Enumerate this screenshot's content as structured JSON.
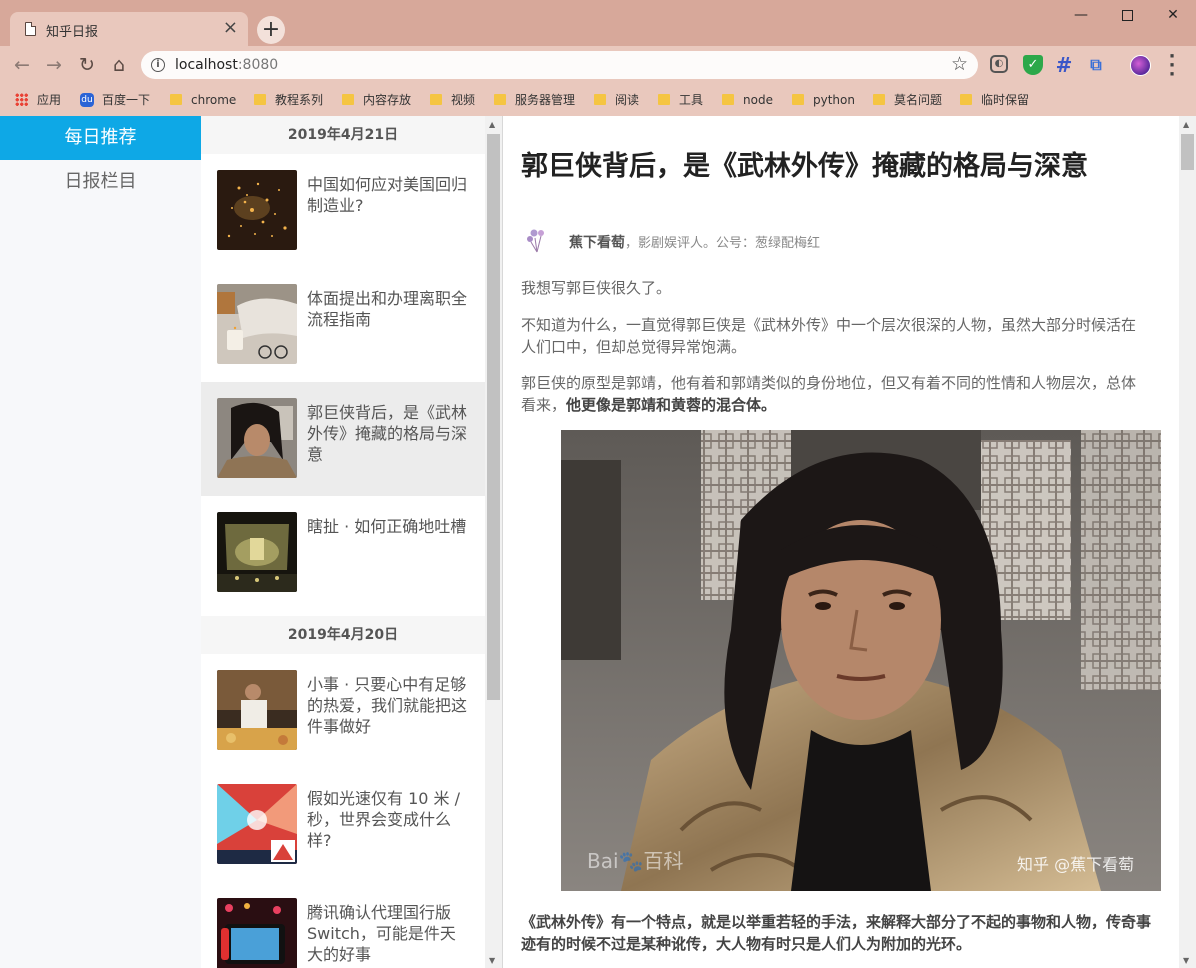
{
  "browser": {
    "tab_title": "知乎日报",
    "tab_close": "×",
    "new_tab": "+",
    "url_host": "localhost",
    "url_port": ":8080",
    "window": {
      "minimize": "—",
      "close": "✕"
    },
    "bookmarks": [
      {
        "label": "应用",
        "icon": "apps-icon"
      },
      {
        "label": "百度一下",
        "icon": "baidu-icon"
      },
      {
        "label": "chrome",
        "icon": "folder-icon"
      },
      {
        "label": "教程系列",
        "icon": "folder-icon"
      },
      {
        "label": "内容存放",
        "icon": "folder-icon"
      },
      {
        "label": "视频",
        "icon": "folder-icon"
      },
      {
        "label": "服务器管理",
        "icon": "folder-icon"
      },
      {
        "label": "阅读",
        "icon": "folder-icon"
      },
      {
        "label": "工具",
        "icon": "folder-icon"
      },
      {
        "label": "node",
        "icon": "folder-icon"
      },
      {
        "label": "python",
        "icon": "folder-icon"
      },
      {
        "label": "莫名问题",
        "icon": "folder-icon"
      },
      {
        "label": "临时保留",
        "icon": "folder-icon"
      }
    ]
  },
  "sidebar": {
    "items": [
      {
        "label": "每日推荐",
        "active": true
      },
      {
        "label": "日报栏目",
        "active": false
      }
    ]
  },
  "list": {
    "groups": [
      {
        "date": "2019年4月21日",
        "items": [
          {
            "title": "中国如何应对美国回归制造业?"
          },
          {
            "title": "体面提出和办理离职全流程指南"
          },
          {
            "title": "郭巨侠背后，是《武林外传》掩藏的格局与深意",
            "selected": true
          },
          {
            "title": "瞎扯 · 如何正确地吐槽"
          }
        ]
      },
      {
        "date": "2019年4月20日",
        "items": [
          {
            "title": "小事 · 只要心中有足够的热爱，我们就能把这件事做好"
          },
          {
            "title": "假如光速仅有 10 米 / 秒，世界会变成什么样?"
          },
          {
            "title": "腾讯确认代理国行版 Switch，可能是件天大的好事"
          }
        ]
      }
    ]
  },
  "article": {
    "title": "郭巨侠背后，是《武林外传》掩藏的格局与深意",
    "author_name": "蕉下看萄",
    "author_bio": "，影剧娱评人。公号：葱绿配梅红",
    "p1": "我想写郭巨侠很久了。",
    "p2": "不知道为什么，一直觉得郭巨侠是《武林外传》中一个层次很深的人物，虽然大部分时候活在人们口中，但却总觉得异常饱满。",
    "p3": "郭巨侠的原型是郭靖，他有着和郭靖类似的身份地位，但又有着不同的性情和人物层次，总体看来，",
    "p3_bold": "他更像是郭靖和黄蓉的混合体。",
    "watermark_left": "Bai🐾百科",
    "watermark_right": "知乎 @蕉下看萄",
    "p4": "《武林外传》有一个特点，就是以举重若轻的手法，来解释大部分了不起的事物和人物，传奇事迹有的时候不过是某种讹传，大人物有时只是人们人为附加的光环。"
  }
}
